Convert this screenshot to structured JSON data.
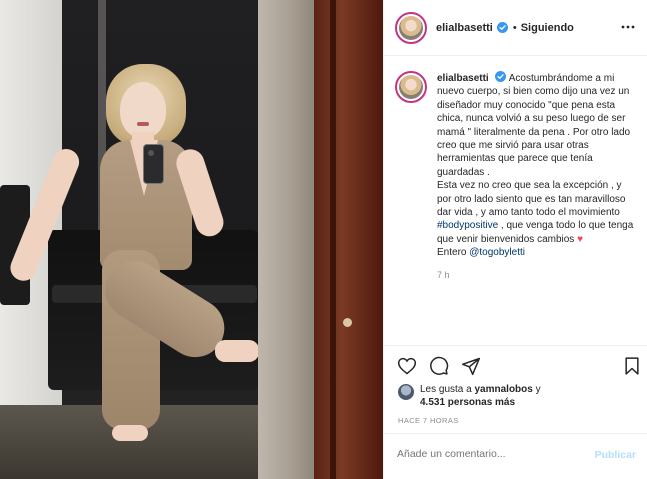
{
  "header": {
    "username": "elialbasetti",
    "separator": "•",
    "follow_status": "Siguiendo"
  },
  "caption": {
    "username": "elialbasetti",
    "line1": "Acostumbrándome a mi nuevo cuerpo, si bien como dijo una vez un diseñador muy conocido \"que pena esta chica, nunca volvió a su peso luego de ser mamá \" literalmente da pena . Por otro lado creo que me sirvió para usar otras herramientas que parece que tenía guardadas .",
    "line2_pre": "Esta vez no creo que sea la excepción , y por otro lado siento que es tan maravilloso dar vida , y amo tanto todo el movimiento ",
    "hashtag": "#bodypositive",
    "line2_post": " , que venga todo lo que tenga que venir bienvenidos cambios ",
    "heart": "♥",
    "line3_pre": "Entero ",
    "mention": "@togobyletti",
    "time": "7 h"
  },
  "likes": {
    "prefix": "Les gusta a ",
    "user": "yamnalobos",
    "connector": " y",
    "count": "4.531 personas más"
  },
  "timestamp": "HACE 7 HORAS",
  "comment": {
    "placeholder": "Añade un comentario...",
    "publish_label": "Publicar"
  },
  "colors": {
    "verified": "#3897f0",
    "link": "#00376b",
    "heart": "#ed4956",
    "publish_disabled": "#b2dffc"
  },
  "icons": [
    "more-options-icon",
    "verified-badge-icon",
    "heart-icon",
    "comment-icon",
    "share-icon",
    "bookmark-icon"
  ]
}
